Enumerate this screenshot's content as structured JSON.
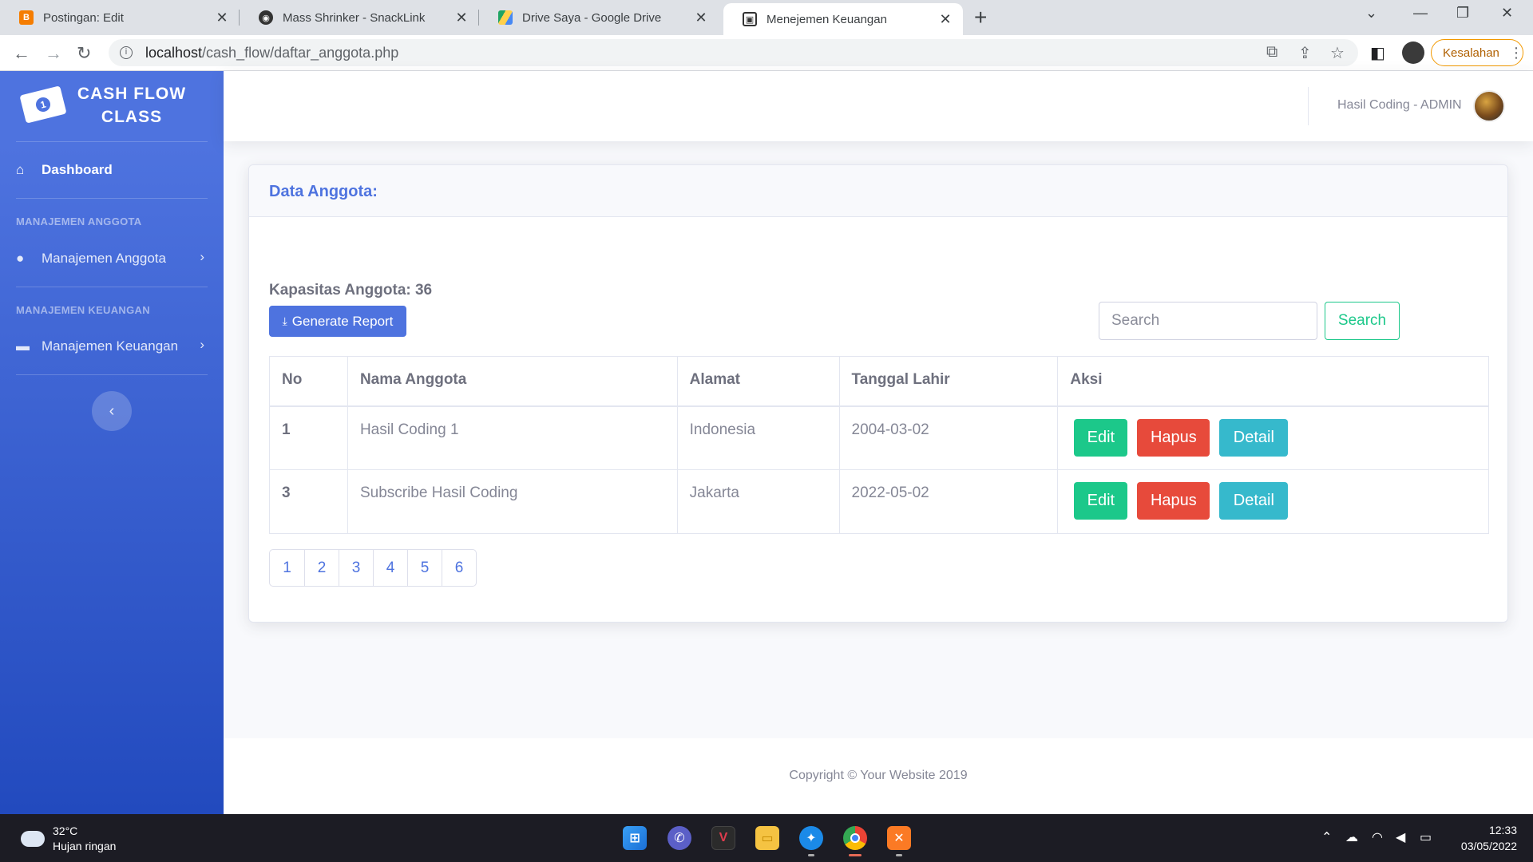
{
  "browser": {
    "tabs": [
      {
        "label": "Postingan: Edit",
        "icon": "blogger-icon",
        "color": "#f57d00"
      },
      {
        "label": "Mass Shrinker - SnackLink",
        "icon": "snacklink-icon",
        "color": "#333333"
      },
      {
        "label": "Drive Saya - Google Drive",
        "icon": "google-drive-icon",
        "color": "#1fa463"
      },
      {
        "label": "Menejemen Keuangan",
        "icon": "site-favicon",
        "color": "#4e73df"
      }
    ],
    "url_host": "localhost",
    "url_path": "/cash_flow/daftar_anggota.php",
    "error_label": "Kesalahan"
  },
  "sidebar": {
    "brand": "CASH FLOW CLASS",
    "dashboard": "Dashboard",
    "heading_anggota": "MANAJEMEN ANGGOTA",
    "item_anggota": "Manajemen Anggota",
    "heading_keuangan": "MANAJEMEN KEUANGAN",
    "item_keuangan": "Manajemen Keuangan"
  },
  "topbar": {
    "user": "Hasil Coding - ADMIN"
  },
  "card": {
    "title": "Data Anggota:",
    "capacity": "Kapasitas Anggota: 36",
    "generate_label": "Generate Report",
    "search_placeholder": "Search",
    "search_button": "Search"
  },
  "table": {
    "headers": [
      "No",
      "Nama Anggota",
      "Alamat",
      "Tanggal Lahir",
      "Aksi"
    ],
    "rows": [
      {
        "no": "1",
        "nama": "Hasil Coding 1",
        "alamat": "Indonesia",
        "tanggal": "2004-03-02"
      },
      {
        "no": "3",
        "nama": "Subscribe Hasil Coding",
        "alamat": "Jakarta",
        "tanggal": "2022-05-02"
      }
    ],
    "actions": {
      "edit": "Edit",
      "hapus": "Hapus",
      "detail": "Detail"
    }
  },
  "pagination": [
    "1",
    "2",
    "3",
    "4",
    "5",
    "6"
  ],
  "footer": "Copyright © Your Website 2019",
  "taskbar": {
    "temperature": "32°C",
    "weather": "Hujan ringan",
    "time": "12:33",
    "date": "03/05/2022"
  },
  "colors": {
    "primary": "#4e73df",
    "success": "#1cc88a",
    "danger": "#e74a3b",
    "info": "#36b9cc"
  }
}
